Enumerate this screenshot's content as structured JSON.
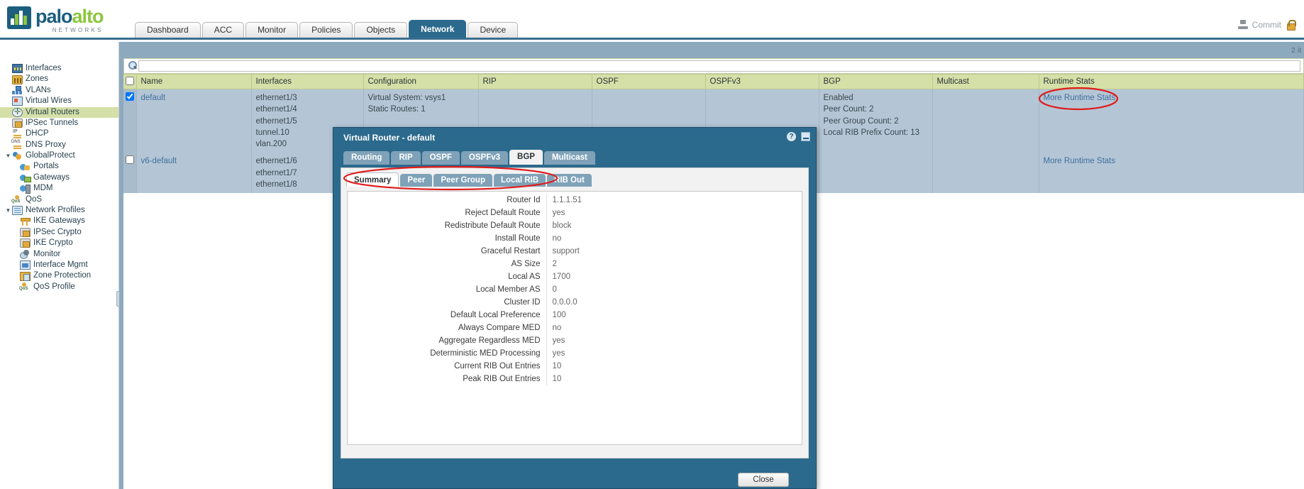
{
  "brand": {
    "name_part1": "palo",
    "name_part2": "alto",
    "subtitle": "NETWORKS",
    "accent": "#8cc63e",
    "primary": "#1b5e7e"
  },
  "header": {
    "tabs": [
      {
        "label": "Dashboard",
        "active": false
      },
      {
        "label": "ACC",
        "active": false
      },
      {
        "label": "Monitor",
        "active": false
      },
      {
        "label": "Policies",
        "active": false
      },
      {
        "label": "Objects",
        "active": false
      },
      {
        "label": "Network",
        "active": true
      },
      {
        "label": "Device",
        "active": false
      }
    ],
    "commit_label": "Commit",
    "commit_icon": "commit-icon",
    "lock_icon": "lock-icon"
  },
  "sidebar": {
    "items": [
      {
        "label": "Interfaces",
        "icon": "interfaces-icon",
        "indent": 1,
        "arrow": "",
        "selected": false
      },
      {
        "label": "Zones",
        "icon": "zones-icon",
        "indent": 1,
        "arrow": "",
        "selected": false
      },
      {
        "label": "VLANs",
        "icon": "vlans-icon",
        "indent": 1,
        "arrow": "",
        "selected": false
      },
      {
        "label": "Virtual Wires",
        "icon": "virtual-wires-icon",
        "indent": 1,
        "arrow": "",
        "selected": false
      },
      {
        "label": "Virtual Routers",
        "icon": "virtual-routers-icon",
        "indent": 1,
        "arrow": "",
        "selected": true
      },
      {
        "label": "IPSec Tunnels",
        "icon": "ipsec-tunnels-icon",
        "indent": 1,
        "arrow": "",
        "selected": false
      },
      {
        "label": "DHCP",
        "icon": "dhcp-icon",
        "indent": 1,
        "arrow": "",
        "selected": false
      },
      {
        "label": "DNS Proxy",
        "icon": "dns-proxy-icon",
        "indent": 1,
        "arrow": "",
        "selected": false
      },
      {
        "label": "GlobalProtect",
        "icon": "globalprotect-icon",
        "indent": 0,
        "arrow": "▼",
        "selected": false
      },
      {
        "label": "Portals",
        "icon": "portals-icon",
        "indent": 2,
        "arrow": "",
        "selected": false
      },
      {
        "label": "Gateways",
        "icon": "gateways-icon",
        "indent": 2,
        "arrow": "",
        "selected": false
      },
      {
        "label": "MDM",
        "icon": "mdm-icon",
        "indent": 2,
        "arrow": "",
        "selected": false
      },
      {
        "label": "QoS",
        "icon": "qos-icon",
        "indent": 1,
        "arrow": "",
        "selected": false
      },
      {
        "label": "Network Profiles",
        "icon": "network-profiles-icon",
        "indent": 0,
        "arrow": "▼",
        "selected": false
      },
      {
        "label": "IKE Gateways",
        "icon": "ike-gateways-icon",
        "indent": 2,
        "arrow": "",
        "selected": false
      },
      {
        "label": "IPSec Crypto",
        "icon": "ipsec-crypto-icon",
        "indent": 2,
        "arrow": "",
        "selected": false
      },
      {
        "label": "IKE Crypto",
        "icon": "ike-crypto-icon",
        "indent": 2,
        "arrow": "",
        "selected": false
      },
      {
        "label": "Monitor",
        "icon": "monitor-icon",
        "indent": 2,
        "arrow": "",
        "selected": false
      },
      {
        "label": "Interface Mgmt",
        "icon": "interface-mgmt-icon",
        "indent": 2,
        "arrow": "",
        "selected": false
      },
      {
        "label": "Zone Protection",
        "icon": "zone-protection-icon",
        "indent": 2,
        "arrow": "",
        "selected": false
      },
      {
        "label": "QoS Profile",
        "icon": "qos-profile-icon",
        "indent": 2,
        "arrow": "",
        "selected": false
      }
    ]
  },
  "search": {
    "value": "",
    "placeholder": "",
    "icon": "search-icon"
  },
  "table": {
    "items_count_text": "2 it",
    "columns": [
      "Name",
      "Interfaces",
      "Configuration",
      "RIP",
      "OSPF",
      "OSPFv3",
      "BGP",
      "Multicast",
      "Runtime Stats"
    ],
    "rows": [
      {
        "checked": true,
        "name": "default",
        "interfaces": [
          "ethernet1/3",
          "ethernet1/4",
          "ethernet1/5",
          "tunnel.10",
          "vlan.200"
        ],
        "configuration": [
          "Virtual System: vsys1",
          "Static Routes: 1"
        ],
        "configuration_link": "vsys1",
        "rip": [],
        "ospf": [],
        "ospfv3": [],
        "bgp": [
          "Enabled",
          "Peer Count: 2",
          "Peer Group Count: 2",
          "Local RIB Prefix Count: 13"
        ],
        "multicast": [],
        "runtime_stats": "More Runtime Stats"
      },
      {
        "checked": false,
        "name": "v6-default",
        "interfaces": [
          "ethernet1/6",
          "ethernet1/7",
          "ethernet1/8"
        ],
        "configuration": [],
        "configuration_link": "",
        "rip": [],
        "ospf": [],
        "ospfv3": [],
        "bgp": [],
        "multicast": [],
        "runtime_stats": "More Runtime Stats"
      }
    ]
  },
  "dialog": {
    "title": "Virtual Router - default",
    "help_icon": "help-icon",
    "minimize_icon": "minimize-icon",
    "tabs": [
      {
        "label": "Routing",
        "active": false
      },
      {
        "label": "RIP",
        "active": false
      },
      {
        "label": "OSPF",
        "active": false
      },
      {
        "label": "OSPFv3",
        "active": false
      },
      {
        "label": "BGP",
        "active": true
      },
      {
        "label": "Multicast",
        "active": false
      }
    ],
    "subtabs": [
      {
        "label": "Summary",
        "active": true
      },
      {
        "label": "Peer",
        "active": false
      },
      {
        "label": "Peer Group",
        "active": false
      },
      {
        "label": "Local RIB",
        "active": false
      },
      {
        "label": "RIB Out",
        "active": false
      }
    ],
    "summary": [
      {
        "key": "Router Id",
        "value": "1.1.1.51"
      },
      {
        "key": "Reject Default Route",
        "value": "yes"
      },
      {
        "key": "Redistribute Default Route",
        "value": "block"
      },
      {
        "key": "Install Route",
        "value": "no"
      },
      {
        "key": "Graceful Restart",
        "value": "support"
      },
      {
        "key": "AS Size",
        "value": "2"
      },
      {
        "key": "Local AS",
        "value": "1700"
      },
      {
        "key": "Local Member AS",
        "value": "0"
      },
      {
        "key": "Cluster ID",
        "value": "0.0.0.0"
      },
      {
        "key": "Default Local Preference",
        "value": "100"
      },
      {
        "key": "Always Compare MED",
        "value": "no"
      },
      {
        "key": "Aggregate Regardless MED",
        "value": "yes"
      },
      {
        "key": "Deterministic MED Processing",
        "value": "yes"
      },
      {
        "key": "Current RIB Out Entries",
        "value": "10"
      },
      {
        "key": "Peak RIB Out Entries",
        "value": "10"
      }
    ],
    "close_label": "Close"
  },
  "annotations": {
    "color": "#e01b1b",
    "marks": [
      "more-runtime-stats-ellipse",
      "subtabs-ellipse"
    ]
  }
}
